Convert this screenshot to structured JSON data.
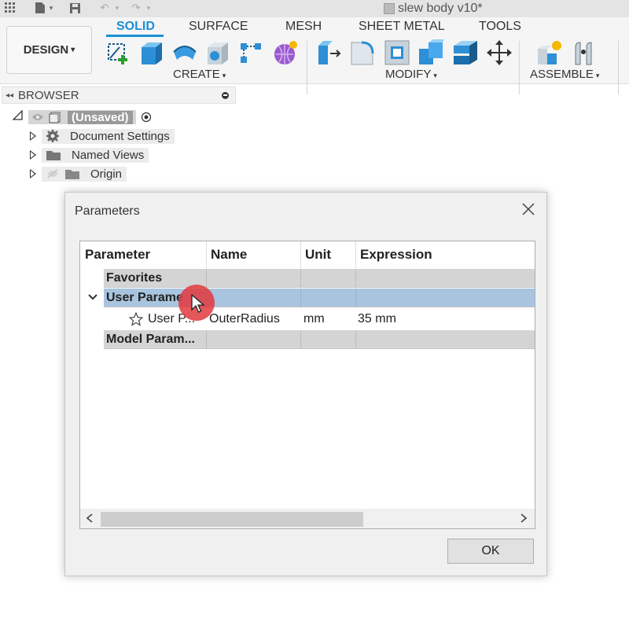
{
  "window": {
    "document_title": "slew body v10*"
  },
  "toolbar": {
    "workspace_label": "DESIGN",
    "tabs": [
      {
        "label": "SOLID",
        "active": true
      },
      {
        "label": "SURFACE",
        "active": false
      },
      {
        "label": "MESH",
        "active": false
      },
      {
        "label": "SHEET METAL",
        "active": false
      },
      {
        "label": "TOOLS",
        "active": false
      }
    ],
    "groups": {
      "create": "CREATE",
      "modify": "MODIFY",
      "assemble": "ASSEMBLE"
    }
  },
  "browser": {
    "header": "BROWSER",
    "root_label": "(Unsaved)",
    "items": [
      {
        "label": "Document Settings",
        "icon": "gear-icon"
      },
      {
        "label": "Named Views",
        "icon": "folder-icon"
      },
      {
        "label": "Origin",
        "icon": "folder-icon"
      }
    ]
  },
  "dialog": {
    "title": "Parameters",
    "columns": [
      "Parameter",
      "Name",
      "Unit",
      "Expression"
    ],
    "groups": {
      "favorites": "Favorites",
      "user": "User Parame",
      "model": "Model Param..."
    },
    "param_row": {
      "parameter": "User P...",
      "name": "OuterRadius",
      "unit": "mm",
      "expression": "35 mm"
    },
    "ok_label": "OK"
  },
  "colors": {
    "accent": "#1a8fd6",
    "selected_row": "#a9c4de",
    "cursor_highlight": "#e23a3e"
  }
}
